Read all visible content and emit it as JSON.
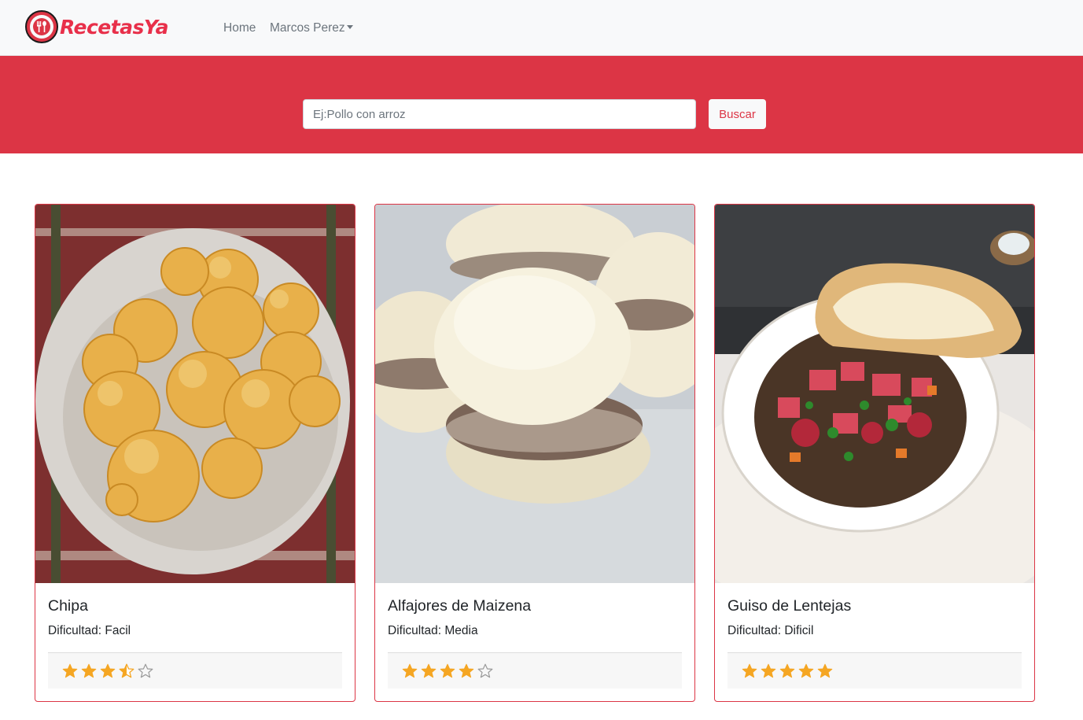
{
  "navbar": {
    "brand": "RecetasYa",
    "links": [
      {
        "label": "Home"
      },
      {
        "label": "Marcos Perez"
      }
    ]
  },
  "search": {
    "placeholder": "Ej:Pollo con arroz",
    "value": "",
    "button_label": "Buscar"
  },
  "colors": {
    "brand_red": "#dc3545",
    "star_gold": "#f5a623",
    "navbar_bg": "#f8f9fa"
  },
  "recipes": [
    {
      "title": "Chipa",
      "difficulty": "Dificultad: Facil",
      "rating": 3.5,
      "max_rating": 5,
      "image": "cheese-bread-balls-photo"
    },
    {
      "title": "Alfajores de Maizena",
      "difficulty": "Dificultad: Media",
      "rating": 4,
      "max_rating": 5,
      "image": "alfajores-photo"
    },
    {
      "title": "Guiso de Lentejas",
      "difficulty": "Dificultad: Dificil",
      "rating": 5,
      "max_rating": 5,
      "image": "lentil-stew-photo"
    }
  ]
}
